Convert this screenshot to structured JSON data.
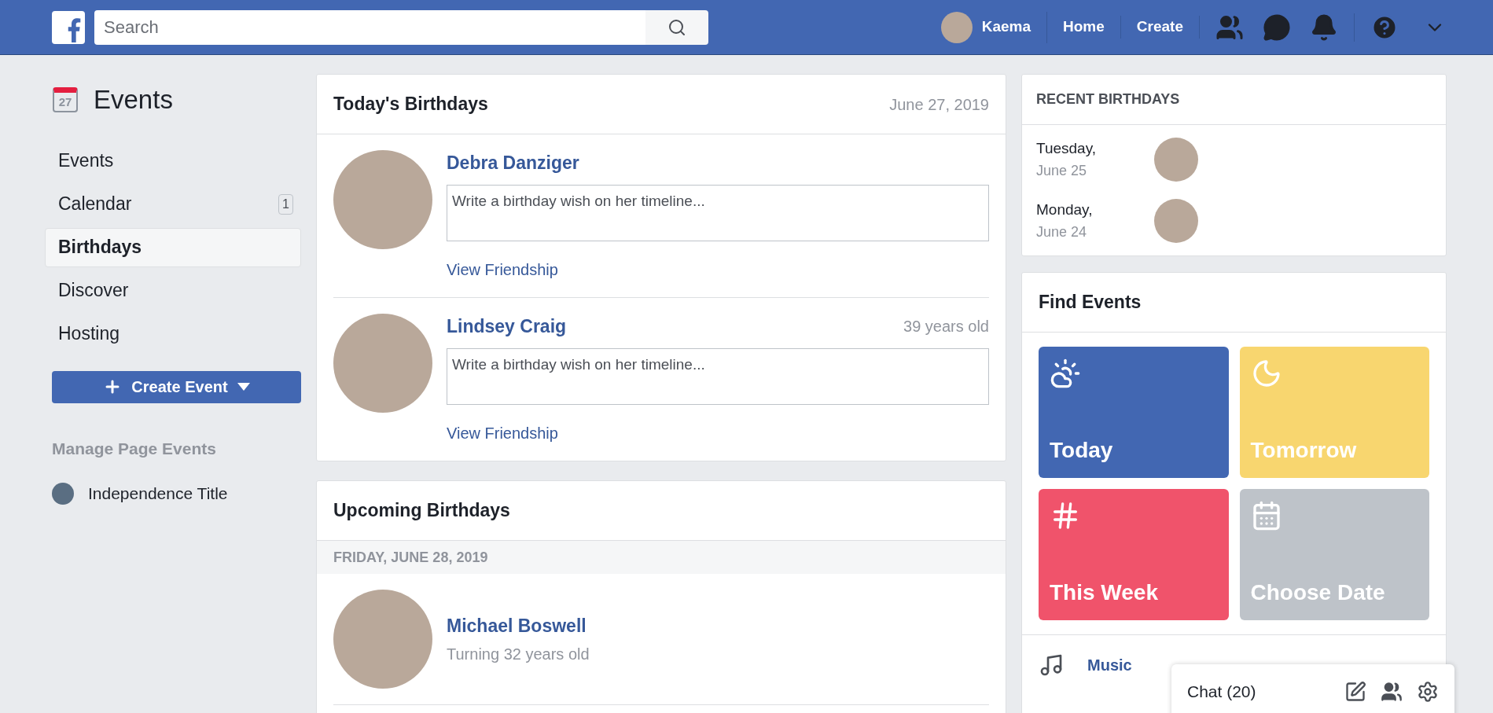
{
  "topbar": {
    "search": {
      "placeholder": "Search"
    },
    "profile_name": "Kaema",
    "nav": [
      "Home",
      "Create"
    ]
  },
  "sidebar": {
    "title": "Events",
    "calendar_day": "27",
    "items": [
      {
        "label": "Events",
        "selected": false
      },
      {
        "label": "Calendar",
        "selected": false,
        "badge": "1"
      },
      {
        "label": "Birthdays",
        "selected": true
      },
      {
        "label": "Discover",
        "selected": false
      },
      {
        "label": "Hosting",
        "selected": false
      }
    ],
    "create_button": "Create Event",
    "manage_heading": "Manage Page Events",
    "pages": [
      "Independence Title"
    ]
  },
  "todays_birthdays": {
    "title": "Today's Birthdays",
    "date": "June 27, 2019",
    "people": [
      {
        "name": "Debra Danziger",
        "placeholder": "Write a birthday wish on her timeline...",
        "link": "View Friendship"
      },
      {
        "name": "Lindsey Craig",
        "age": "39 years old",
        "placeholder": "Write a birthday wish on her timeline...",
        "link": "View Friendship"
      }
    ]
  },
  "upcoming_birthdays": {
    "title": "Upcoming Birthdays",
    "date_heading": "FRIDAY, JUNE 28, 2019",
    "people": [
      {
        "name": "Michael Boswell",
        "subtitle": "Turning 32 years old"
      }
    ]
  },
  "recent_birthdays": {
    "title": "RECENT BIRTHDAYS",
    "days": [
      {
        "day": "Tuesday,",
        "date": "June 25"
      },
      {
        "day": "Monday,",
        "date": "June 24"
      }
    ]
  },
  "find_events": {
    "title": "Find Events",
    "tiles": [
      {
        "label": "Today",
        "kind": "weather",
        "color": "#4267b2"
      },
      {
        "label": "Tomorrow",
        "kind": "moon",
        "color": "#f8d66f"
      },
      {
        "label": "This Week",
        "kind": "week",
        "color": "#f0536b"
      },
      {
        "label": "Choose Date",
        "kind": "calendar",
        "color": "#bec3c9"
      }
    ],
    "categories": [
      "Music"
    ]
  },
  "chat": {
    "label": "Chat (20)"
  }
}
